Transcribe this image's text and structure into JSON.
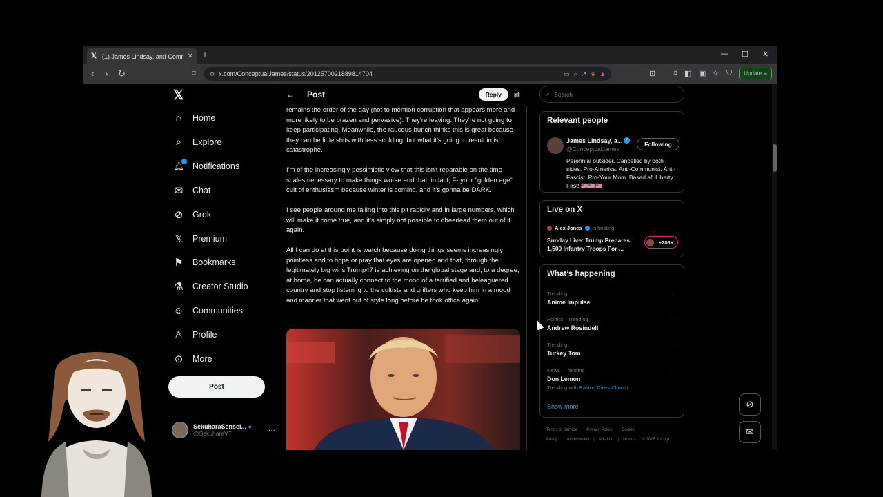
{
  "browser": {
    "tab_title": "(1) James Lindsay, anti-Commun",
    "url": "x.com/ConceptualJames/status/2012570021889814704",
    "update_label": "Update"
  },
  "nav": {
    "items": [
      {
        "label": "Home",
        "icon": "home-icon"
      },
      {
        "label": "Explore",
        "icon": "search-icon"
      },
      {
        "label": "Notifications",
        "icon": "bell-icon"
      },
      {
        "label": "Chat",
        "icon": "mail-icon"
      },
      {
        "label": "Grok",
        "icon": "grok-icon"
      },
      {
        "label": "Premium",
        "icon": "x-icon"
      },
      {
        "label": "Bookmarks",
        "icon": "bookmark-icon"
      },
      {
        "label": "Creator Studio",
        "icon": "flask-icon"
      },
      {
        "label": "Communities",
        "icon": "people-icon"
      },
      {
        "label": "Profile",
        "icon": "person-icon"
      },
      {
        "label": "More",
        "icon": "more-circle-icon"
      }
    ],
    "post_button": "Post",
    "account": {
      "display_name": "SekuharaSensei...",
      "handle": "@SekuharaVT"
    }
  },
  "post": {
    "header_title": "Post",
    "reply_label": "Reply",
    "paragraphs": [
      "remains the order of the day (not to mention corruption that appears more and more likely to be brazen and pervasive). They're leaving. They're not going to keep participating. Meanwhile, the raucous bunch thinks this is great because they can be little shits with less scolding, but what it's going to result in is catastrophe.",
      "I'm of the increasingly pessimistic view that this isn't reparable on the time scales necessary to make things worse and that, in fact, F- your \"golden age\" cult of enthusiasm because winter is coming, and it's gonna be DARK.",
      "I see people around me falling into this pit rapidly and in large numbers, which will make it come true, and it's simply not possible to cheerlead them out of it again.",
      "All I can do at this point is watch because doing things seems increasingly pointless and to hope or pray that eyes are opened and that, through the legitimately big wins Trump47 is achieving on the global stage and, to a degree, at home, he can actually connect to the mood of a terrified and beleaguered country and stop listening to the cultists and grifters who keep him in a mood and manner that went out of style long before he took office again."
    ]
  },
  "right": {
    "search_placeholder": "Search",
    "relevant": {
      "title": "Relevant people",
      "name": "James Lindsay, a...",
      "handle": "@ConceptualJames",
      "follow_label": "Following",
      "bio": "Perennial outsider. Cancelled by both sides. Pro-America. Anti-Communist. Anti-Fascist. Pro-Your Mom. Based af. Liberty First! 🇺🇸🇺🇸🇺🇸"
    },
    "live": {
      "title": "Live on X",
      "host": "Alex Jones",
      "hosting": "is hosting",
      "stream_title": "Sunday Live: Trump Prepares 1,500 Infantry Troops For ...",
      "count": "+286K"
    },
    "happening": {
      "title": "What’s happening",
      "trends": [
        {
          "context": "Trending",
          "name": "Anime Impulse"
        },
        {
          "context": "Politics · Trending",
          "name": "Andrew Rosindell"
        },
        {
          "context": "Trending",
          "name": "Turkey Tom"
        },
        {
          "context": "News · Trending",
          "name": "Don Lemon",
          "with_prefix": "Trending with",
          "with_links": "Pastor, Cities Church"
        }
      ],
      "show_more": "Show more"
    },
    "footer": [
      "Terms of Service",
      "|",
      "Privacy Policy",
      "|",
      "Cookie Policy",
      "|",
      "Accessibility",
      "|",
      "Ads info",
      "|",
      "More ···",
      "© 2026 X Corp."
    ]
  }
}
